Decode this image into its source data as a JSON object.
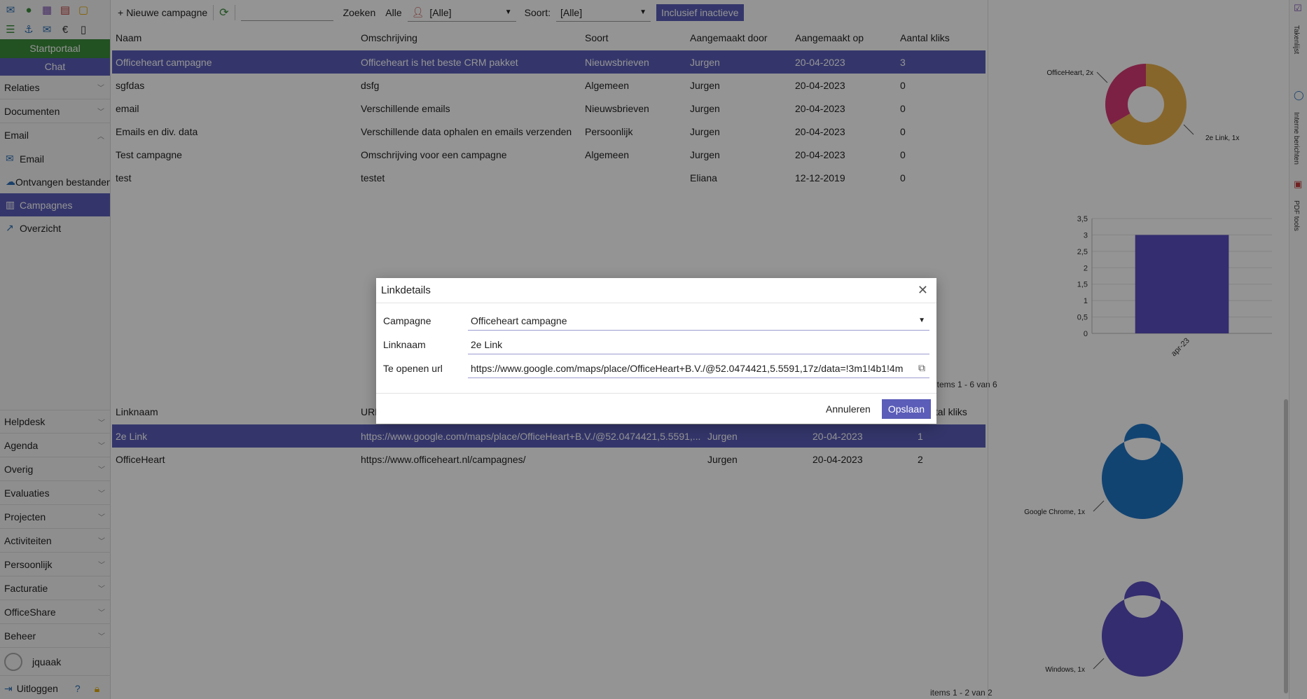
{
  "sidebar": {
    "portal": "Startportaal",
    "chat": "Chat",
    "sections_top": [
      "Relaties",
      "Documenten"
    ],
    "email_section": "Email",
    "email_items": [
      "Email",
      "Ontvangen bestanden",
      "Campagnes",
      "Overzicht"
    ],
    "sections_bottom": [
      "Helpdesk",
      "Agenda",
      "Overig",
      "Evaluaties",
      "Projecten",
      "Activiteiten",
      "Persoonlijk",
      "Facturatie",
      "OfficeShare",
      "Beheer"
    ],
    "user": "jquaak",
    "logout": "Uitloggen",
    "help": "?"
  },
  "toolbar": {
    "new_campaign": "Nieuwe campagne",
    "search": "Zoeken",
    "all": "Alle",
    "user_filter": "[Alle]",
    "sort_label": "Soort:",
    "sort_value": "[Alle]",
    "include_inactive": "Inclusief inactieve"
  },
  "campaigns": {
    "headers": [
      "Naam",
      "Omschrijving",
      "Soort",
      "Aangemaakt door",
      "Aangemaakt op",
      "Aantal kliks"
    ],
    "rows": [
      [
        "Officeheart campagne",
        "Officeheart is het beste CRM pakket",
        "Nieuwsbrieven",
        "Jurgen",
        "20-04-2023",
        "3"
      ],
      [
        "sgfdas",
        "dsfg",
        "Algemeen",
        "Jurgen",
        "20-04-2023",
        "0"
      ],
      [
        "email",
        "Verschillende emails",
        "Nieuwsbrieven",
        "Jurgen",
        "20-04-2023",
        "0"
      ],
      [
        "Emails en div. data",
        "Verschillende data ophalen en emails verzenden",
        "Persoonlijk",
        "Jurgen",
        "20-04-2023",
        "0"
      ],
      [
        "Test campagne",
        "Omschrijving voor een campagne",
        "Algemeen",
        "Jurgen",
        "20-04-2023",
        "0"
      ],
      [
        "test",
        "testet",
        "",
        "Eliana",
        "12-12-2019",
        "0"
      ]
    ],
    "footer": "items 1 - 6 van 6"
  },
  "links": {
    "headers": [
      "Linknaam",
      "URL",
      "",
      "",
      "Aantal kliks"
    ],
    "rows": [
      [
        "2e Link",
        "https://www.google.com/maps/place/OfficeHeart+B.V./@52.0474421,5.5591,...",
        "Jurgen",
        "20-04-2023",
        "1"
      ],
      [
        "OfficeHeart",
        "https://www.officeheart.nl/campagnes/",
        "Jurgen",
        "20-04-2023",
        "2"
      ]
    ],
    "footer": "items 1 - 2 van 2"
  },
  "right_strip": {
    "labels": [
      "Takenlijst",
      "Interne berichten",
      "PDF tools"
    ]
  },
  "modal": {
    "title": "Linkdetails",
    "campaign_label": "Campagne",
    "campaign_value": "Officeheart campagne",
    "linkname_label": "Linknaam",
    "linkname_value": "2e Link",
    "url_label": "Te openen url",
    "url_value": "https://www.google.com/maps/place/OfficeHeart+B.V./@52.0474421,5.5591,17z/data=!3m1!4b1!4m",
    "cancel": "Annuleren",
    "save": "Opslaan"
  },
  "colors": {
    "accent": "#5b5db8",
    "portal_green": "#3c8c3c",
    "donut_gold": "#e8b04a",
    "donut_pink": "#d63a74",
    "donut_blue": "#1f75c4",
    "donut_purple": "#5b4fc0"
  },
  "chart_data": [
    {
      "type": "pie",
      "labels": [
        "OfficeHeart, 2x",
        "2e Link, 1x"
      ],
      "values": [
        2,
        1
      ],
      "colors": [
        "#e8b04a",
        "#d63a74"
      ]
    },
    {
      "type": "bar",
      "categories": [
        "apr-23"
      ],
      "values": [
        3
      ],
      "ylim": [
        0,
        3.5
      ],
      "yticks": [
        "0",
        "0,5",
        "1",
        "1,5",
        "2",
        "2,5",
        "3",
        "3,5"
      ],
      "grid": true
    },
    {
      "type": "pie",
      "labels": [
        "Google Chrome, 1x"
      ],
      "values": [
        1
      ],
      "colors": [
        "#1f75c4"
      ]
    },
    {
      "type": "pie",
      "labels": [
        "Windows, 1x"
      ],
      "values": [
        1
      ],
      "colors": [
        "#5b4fc0"
      ]
    }
  ]
}
